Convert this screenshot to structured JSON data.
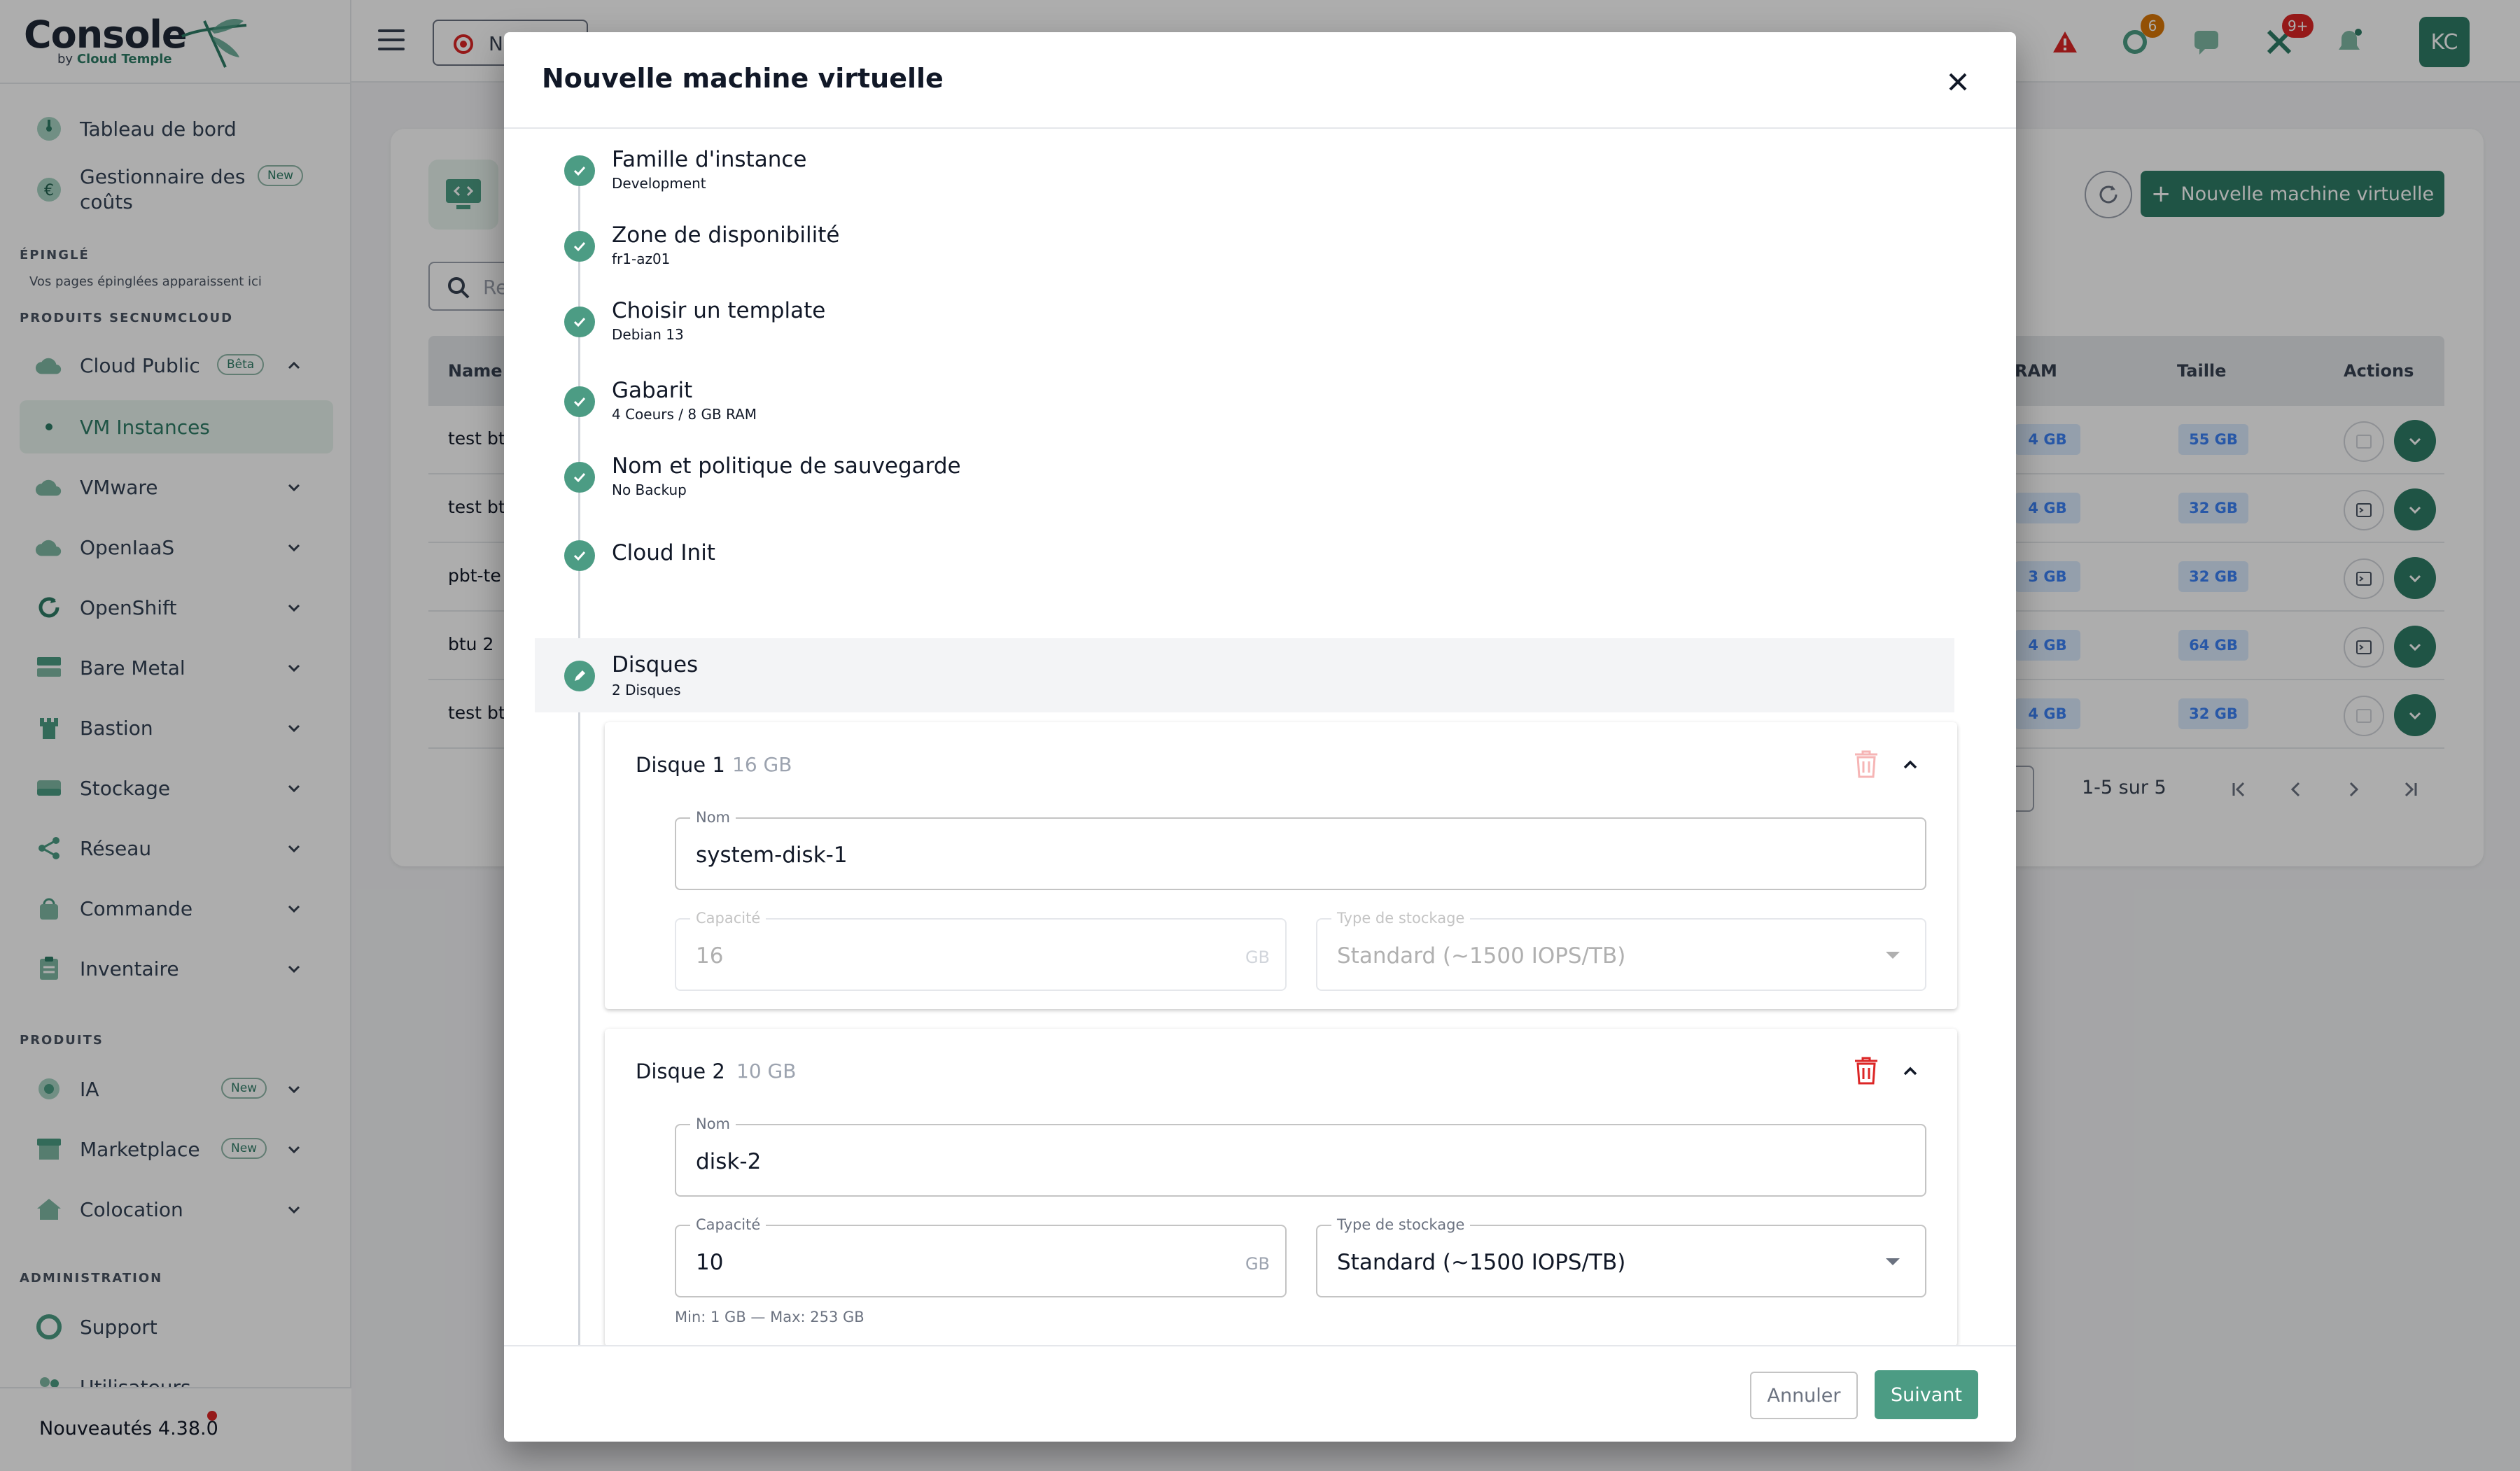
{
  "app": {
    "logo": {
      "name": "Console",
      "by": "by",
      "brand": "Cloud Temple"
    },
    "colors": {
      "accent": "#2f7d66",
      "accent_light": "#4c9c84",
      "danger": "#dc2626",
      "chip_bg": "#dbeafe",
      "chip_text": "#3b82f6"
    }
  },
  "sidebar": {
    "top_items": [
      {
        "label": "Tableau de bord",
        "icon": "dashboard-icon"
      },
      {
        "label": "Gestionnaire des coûts",
        "icon": "euro-icon",
        "badge": "New"
      }
    ],
    "pinned": {
      "title": "ÉPINGLÉ",
      "note": "Vos pages épinglées apparaissent ici"
    },
    "secnum": {
      "title": "PRODUITS SECNUMCLOUD",
      "items": [
        {
          "label": "Cloud Public",
          "icon": "cloud-icon",
          "badge": "Bêta"
        },
        {
          "label": "VM Instances",
          "icon": "dot-icon"
        },
        {
          "label": "VMware",
          "icon": "cloud-icon"
        },
        {
          "label": "OpenIaaS",
          "icon": "cloud-icon"
        },
        {
          "label": "OpenShift",
          "icon": "refresh-icon"
        },
        {
          "label": "Bare Metal",
          "icon": "server-icon"
        },
        {
          "label": "Bastion",
          "icon": "tower-icon"
        },
        {
          "label": "Stockage",
          "icon": "storage-icon"
        },
        {
          "label": "Réseau",
          "icon": "network-icon"
        },
        {
          "label": "Commande",
          "icon": "cart-icon"
        },
        {
          "label": "Inventaire",
          "icon": "clipboard-icon"
        }
      ]
    },
    "products": {
      "title": "PRODUITS",
      "items": [
        {
          "label": "IA",
          "icon": "ai-icon",
          "badge": "New"
        },
        {
          "label": "Marketplace",
          "icon": "store-icon",
          "badge": "New"
        },
        {
          "label": "Colocation",
          "icon": "home-icon"
        }
      ]
    },
    "admin": {
      "title": "ADMINISTRATION",
      "items": [
        {
          "label": "Support",
          "icon": "support-icon"
        },
        {
          "label": "Utilisateurs",
          "icon": "users-icon"
        }
      ]
    },
    "news": "Nouveautés 4.38.0"
  },
  "topbar": {
    "project_label": "N",
    "badges": {
      "tickets": "6",
      "alerts": "9+"
    },
    "avatar": "KC"
  },
  "background": {
    "search_placeholder": "Re",
    "new_vm_button": "Nouvelle machine virtuelle",
    "columns": {
      "name": "Name",
      "ram": "RAM",
      "size": "Taille",
      "actions": "Actions"
    },
    "rows": [
      {
        "name": "test btı",
        "ram": "4 GB",
        "size": "55 GB"
      },
      {
        "name": "test btı",
        "ram": "4 GB",
        "size": "32 GB"
      },
      {
        "name": "pbt-te",
        "ram": "3 GB",
        "size": "32 GB"
      },
      {
        "name": "btu 2",
        "ram": "4 GB",
        "size": "64 GB"
      },
      {
        "name": "test btı",
        "ram": "4 GB",
        "size": "32 GB"
      }
    ],
    "pagination": "1-5 sur 5"
  },
  "modal": {
    "title": "Nouvelle machine virtuelle",
    "steps": [
      {
        "title": "Famille d'instance",
        "subtitle": "Development"
      },
      {
        "title": "Zone de disponibilité",
        "subtitle": "fr1-az01"
      },
      {
        "title": "Choisir un template",
        "subtitle": "Debian 13"
      },
      {
        "title": "Gabarit",
        "subtitle": "4 Coeurs / 8 GB RAM"
      },
      {
        "title": "Nom et politique de sauvegarde",
        "subtitle": "No Backup"
      },
      {
        "title": "Cloud Init",
        "subtitle": ""
      },
      {
        "title": "Disques",
        "subtitle": "2 Disques"
      }
    ],
    "disks": [
      {
        "title": "Disque 1",
        "size": "16 GB",
        "name_label": "Nom",
        "name_value": "system-disk-1",
        "capacity_label": "Capacité",
        "capacity_value": "16",
        "capacity_unit": "GB",
        "storage_label": "Type de stockage",
        "storage_value": "Standard (~1500 IOPS/TB)"
      },
      {
        "title": "Disque 2",
        "size": "10 GB",
        "name_label": "Nom",
        "name_value": "disk-2",
        "capacity_label": "Capacité",
        "capacity_value": "10",
        "capacity_unit": "GB",
        "capacity_help": "Min: 1 GB — Max: 253 GB",
        "storage_label": "Type de stockage",
        "storage_value": "Standard (~1500 IOPS/TB)"
      }
    ],
    "footer": {
      "cancel": "Annuler",
      "next": "Suivant"
    }
  }
}
